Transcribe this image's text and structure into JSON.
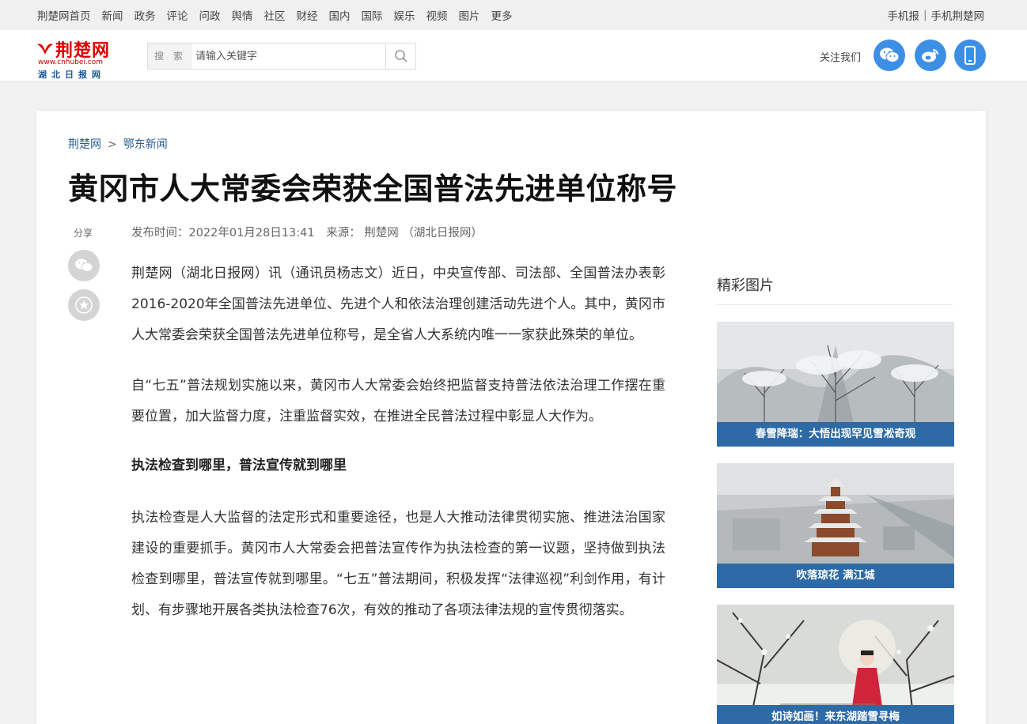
{
  "topnav": {
    "items": [
      "荆楚网首页",
      "新闻",
      "政务",
      "评论",
      "问政",
      "舆情",
      "社区",
      "财经",
      "国内",
      "国际",
      "娱乐",
      "视频",
      "图片",
      "更多"
    ],
    "right_links": [
      "手机报",
      "手机荆楚网"
    ]
  },
  "header": {
    "logo_cn": "荆楚网",
    "logo_domain": "www.cnhubei.com",
    "logo_sub": "湖北日报网",
    "search_label": "搜 索",
    "search_placeholder": "请输入关键字",
    "follow_text": "关注我们",
    "social_icons": [
      "wechat-icon",
      "weibo-icon",
      "mobile-icon"
    ],
    "accent_color": "#3d8fe6"
  },
  "breadcrumb": {
    "items": [
      "荆楚网",
      "鄂东新闻"
    ],
    "separator": ">"
  },
  "article": {
    "title": "黄冈市人大常委会荣获全国普法先进单位称号",
    "share_label": "分享",
    "publish_time": "发布时间：2022年01月28日13:41",
    "source": "来源： 荆楚网 （湖北日报网）",
    "paragraphs": [
      "荆楚网（湖北日报网）讯（通讯员杨志文）近日，中央宣传部、司法部、全国普法办表彰2016-2020年全国普法先进单位、先进个人和依法治理创建活动先进个人。其中，黄冈市人大常委会荣获全国普法先进单位称号，是全省人大系统内唯一一家获此殊荣的单位。",
      "自“七五”普法规划实施以来，黄冈市人大常委会始终把监督支持普法依法治理工作摆在重要位置，加大监督力度，注重监督实效，在推进全民普法过程中彰显人大作为。"
    ],
    "subheading": "执法检查到哪里，普法宣传就到哪里",
    "paragraph3": "执法检查是人大监督的法定形式和重要途径，也是人大推动法律贯彻实施、推进法治国家建设的重要抓手。黄冈市人大常委会把普法宣传作为执法检查的第一议题，坚持做到执法检查到哪里，普法宣传就到哪里。“七五”普法期间，积极发挥“法律巡视”利剑作用，有计划、有步骤地开展各类执法检查76次，有效的推动了各项法律法规的宣传贯彻落实。"
  },
  "sidebar": {
    "title": "精彩图片",
    "pictures": [
      {
        "caption": "春雪降瑞：大悟出现罕见雪凇奇观"
      },
      {
        "caption": "吹落琼花 满江城"
      },
      {
        "caption": "如诗如画！来东湖踏雪寻梅"
      }
    ],
    "caption_bg": "#2d6aa6"
  }
}
